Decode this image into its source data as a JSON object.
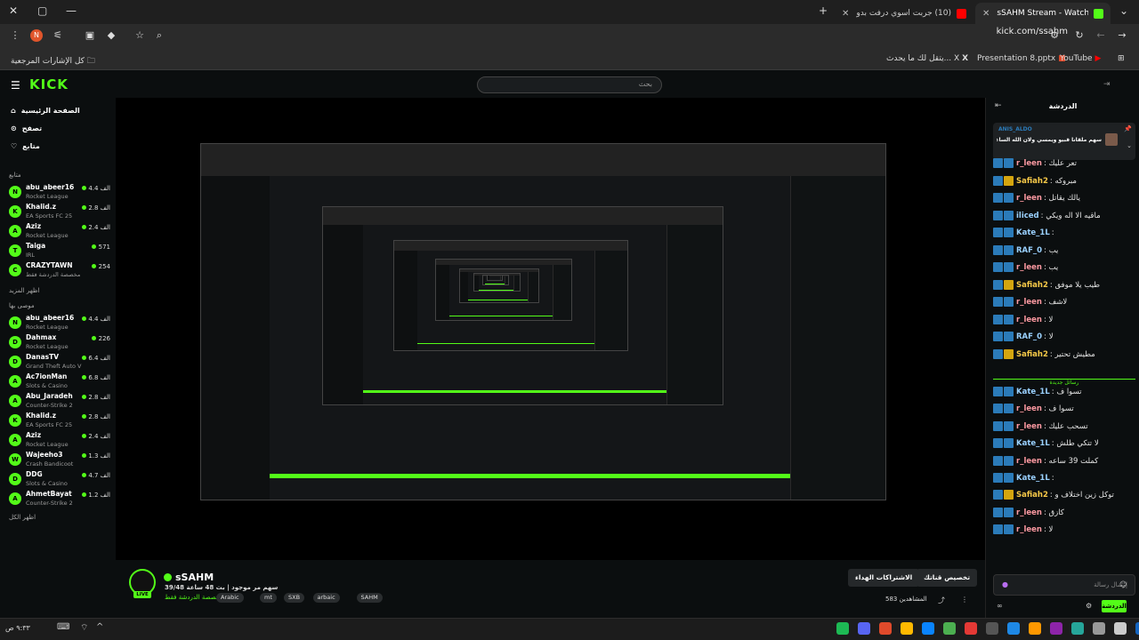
{
  "browser": {
    "tabs": [
      {
        "label": "sSAHM Stream - Watch Live on",
        "favicon": "#53fc18",
        "active": true
      },
      {
        "label": "(10) جربت اسوي درفت بدون ما",
        "favicon": "#ff0000",
        "active": false
      }
    ],
    "new_tab": "+",
    "url": "kick.com/ssahm",
    "bookmarks_left": "كل الإشارات المرجعية",
    "bookmarks": [
      {
        "label": "YouTube",
        "icon": "youtube-icon"
      },
      {
        "label": "Presentation 8.pptx",
        "icon": "office-icon"
      },
      {
        "label": "يتقل لك ما يحدث... X",
        "icon": "x-icon"
      }
    ],
    "profile_letter": "N"
  },
  "kick": {
    "logo": "KICK",
    "search_placeholder": "بحث",
    "nav": [
      {
        "label": "الصفحة الرئيسية",
        "icon": "home-icon"
      },
      {
        "label": "تصفح",
        "icon": "browse-icon"
      },
      {
        "label": "متابع",
        "icon": "heart-icon"
      }
    ],
    "following_head": "متابع",
    "following": [
      {
        "name": "abu_abeer16",
        "game": "Rocket League",
        "viewers": "4.4 الف",
        "av": "N"
      },
      {
        "name": "Khalid.z",
        "game": "EA Sports FC 25",
        "viewers": "2.8 الف",
        "av": "K"
      },
      {
        "name": "Aziz",
        "game": "Rocket League",
        "viewers": "2.4 الف",
        "av": "A"
      },
      {
        "name": "Taiga",
        "game": "IRL",
        "viewers": "571",
        "av": "T"
      },
      {
        "name": "CRAZYTAWN",
        "game": "مخصصة الدردشة فقط",
        "viewers": "254",
        "av": "C"
      }
    ],
    "show_more_1": "اظهر المزيد",
    "recommended_head": "موصى بها",
    "recommended": [
      {
        "name": "abu_abeer16",
        "game": "Rocket League",
        "viewers": "4.4 الف",
        "av": "N"
      },
      {
        "name": "Dahmax",
        "game": "Rocket League",
        "viewers": "226",
        "av": "D"
      },
      {
        "name": "DanasTV",
        "game": "Grand Theft Auto V",
        "viewers": "6.4 الف",
        "av": "D"
      },
      {
        "name": "Ac7ionMan",
        "game": "Slots & Casino",
        "viewers": "6.8 الف",
        "av": "A"
      },
      {
        "name": "Abu_Jaradeh",
        "game": "Counter-Strike 2",
        "viewers": "2.8 الف",
        "av": "A"
      },
      {
        "name": "Khalid.z",
        "game": "EA Sports FC 25",
        "viewers": "2.8 الف",
        "av": "K"
      },
      {
        "name": "Aziz",
        "game": "Rocket League",
        "viewers": "2.4 الف",
        "av": "A"
      },
      {
        "name": "Wajeeho3",
        "game": "Crash Bandicoot",
        "viewers": "1.3 الف",
        "av": "W"
      },
      {
        "name": "DDG",
        "game": "Slots & Casino",
        "viewers": "4.7 الف",
        "av": "D"
      },
      {
        "name": "AhmetBayat",
        "game": "Counter-Strike 2",
        "viewers": "1.2 الف",
        "av": "A"
      }
    ],
    "show_more_2": "اظهر الكل"
  },
  "stream": {
    "streamer": "sSAHM",
    "title": "سهم مر موجود | بث 48 ساعة 39/48",
    "category": "مخصصة الدردشة فقط",
    "tags": [
      "Arabic",
      "mt",
      "SXB",
      "arbaic",
      "SAHM"
    ],
    "live_label": "LIVE",
    "subscribe_label": "الاشتراكات الهداء",
    "customize_label": "تخصيص قناتك",
    "viewers_label": "المشاهدين 583"
  },
  "chat": {
    "header": "الدردشة",
    "pinned_user": "ANIS_ALDO",
    "pinned_text": "سهم ملقانا قبيو ويمسي ولان الله الساعة ١٠ ظم",
    "messages": [
      {
        "user": "r_leen",
        "text": "تعر عليك",
        "color": "#ff9aa2",
        "badge": "b"
      },
      {
        "user": "Safiah2",
        "text": "مبروكه",
        "color": "#f7c948",
        "badge": "y"
      },
      {
        "user": "r_leen",
        "text": "يالك يقاتل",
        "color": "#ff9aa2",
        "badge": "b"
      },
      {
        "user": "iliced",
        "text": "ماقيه الا اله ويكي",
        "color": "#9ad1ff",
        "badge": "b"
      },
      {
        "user": "Kate_1L",
        "text": "",
        "color": "#9ad1ff",
        "badge": "b"
      },
      {
        "user": "RAF_0",
        "text": "يب",
        "color": "#9ad1ff",
        "badge": "b"
      },
      {
        "user": "r_leen",
        "text": "يب",
        "color": "#ff9aa2",
        "badge": "b"
      },
      {
        "user": "Safiah2",
        "text": "طيب يلا موفق",
        "color": "#f7c948",
        "badge": "y"
      },
      {
        "user": "r_leen",
        "text": "لاشف",
        "color": "#ff9aa2",
        "badge": "b"
      },
      {
        "user": "r_leen",
        "text": "لا",
        "color": "#ff9aa2",
        "badge": "b"
      },
      {
        "user": "RAF_0",
        "text": "لا",
        "color": "#9ad1ff",
        "badge": "b"
      },
      {
        "user": "Safiah2",
        "text": "مطيش تحتير",
        "color": "#f7c948",
        "badge": "y"
      }
    ],
    "new_messages_label": "رسائل جديدة",
    "messages2": [
      {
        "user": "Kate_1L",
        "text": "تسوا ف",
        "color": "#9ad1ff",
        "badge": "b"
      },
      {
        "user": "r_leen",
        "text": "تسوا ف",
        "color": "#ff9aa2",
        "badge": "b"
      },
      {
        "user": "r_leen",
        "text": "تسحب عليك",
        "color": "#ff9aa2",
        "badge": "b"
      },
      {
        "user": "Kate_1L",
        "text": "لا تتكي طلش",
        "color": "#9ad1ff",
        "badge": "b"
      },
      {
        "user": "r_leen",
        "text": "كملت 39 ساعه",
        "color": "#ff9aa2",
        "badge": "b"
      },
      {
        "user": "Kate_1L",
        "text": "",
        "color": "#9ad1ff",
        "badge": "b"
      },
      {
        "user": "Safiah2",
        "text": "توكل زين اختلاف و",
        "color": "#f7c948",
        "badge": "y"
      },
      {
        "user": "r_leen",
        "text": "كازق",
        "color": "#ff9aa2",
        "badge": "b"
      },
      {
        "user": "r_leen",
        "text": "لا",
        "color": "#ff9aa2",
        "badge": "b"
      }
    ],
    "input_placeholder": "إرسال رسالة",
    "send_label": "الدردشة"
  },
  "taskbar": {
    "clock": "٩:٣٣ ص"
  }
}
